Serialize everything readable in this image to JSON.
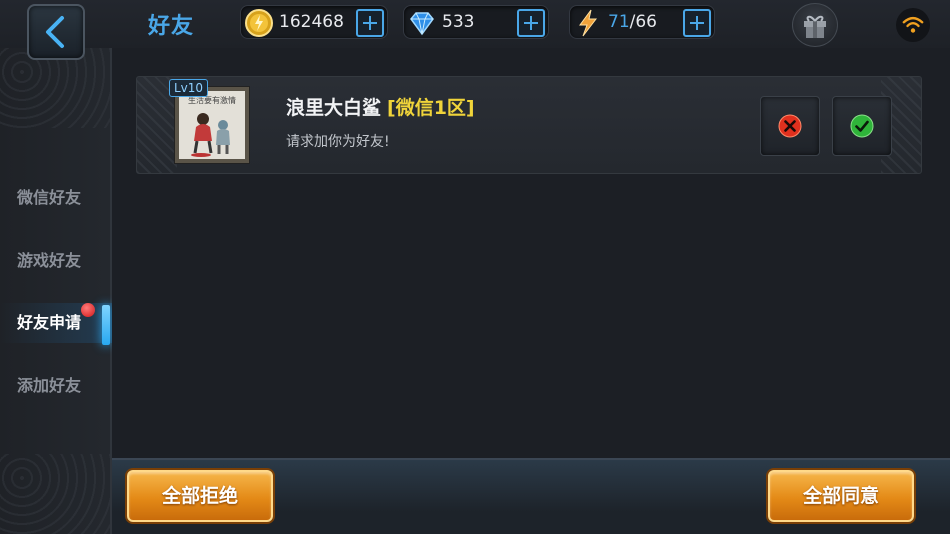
{
  "header": {
    "title": "好友",
    "back_icon": "chevron-left-icon",
    "coins": "162468",
    "diamonds": "533",
    "energy_current": "71",
    "energy_max": "/66",
    "gift_icon": "gift-icon",
    "signal_icon": "wifi-icon"
  },
  "sidebar": {
    "items": [
      {
        "label": "微信好友"
      },
      {
        "label": "游戏好友"
      },
      {
        "label": "好友申请",
        "active": true,
        "badge": "red-dot"
      },
      {
        "label": "添加好友"
      }
    ]
  },
  "request": {
    "level": "Lv10",
    "avatar_caption": "生活要有激情",
    "name": "浪里大白鲨",
    "server": "[微信1区]",
    "message": "请求加你为好友!"
  },
  "footer": {
    "reject_all": "全部拒绝",
    "accept_all": "全部同意"
  },
  "colors": {
    "accent_blue": "#4aa7e8",
    "server_yellow": "#f0d43a",
    "button_gold": "#e48a17",
    "reject_red": "#e0301e",
    "accept_green": "#2fb43a"
  }
}
